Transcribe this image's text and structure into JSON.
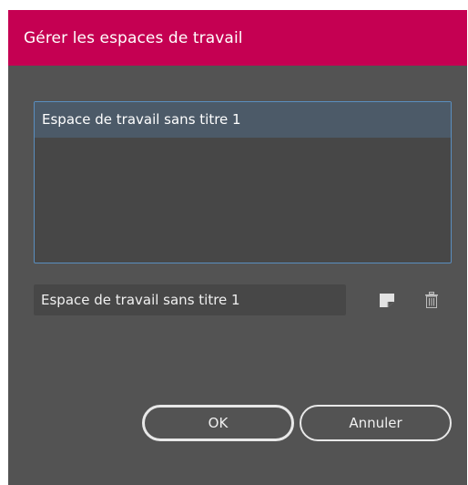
{
  "dialog": {
    "title": "Gérer les espaces de travail",
    "title_bar_color": "#c50052",
    "background_color": "#535353"
  },
  "workspaces": {
    "items": [
      {
        "label": "Espace de travail sans titre 1",
        "selected": true
      }
    ]
  },
  "name_field": {
    "value": "Espace de travail sans titre 1"
  },
  "icons": {
    "new": "new-workspace-icon",
    "delete": "trash-icon"
  },
  "buttons": {
    "ok_label": "OK",
    "cancel_label": "Annuler"
  }
}
